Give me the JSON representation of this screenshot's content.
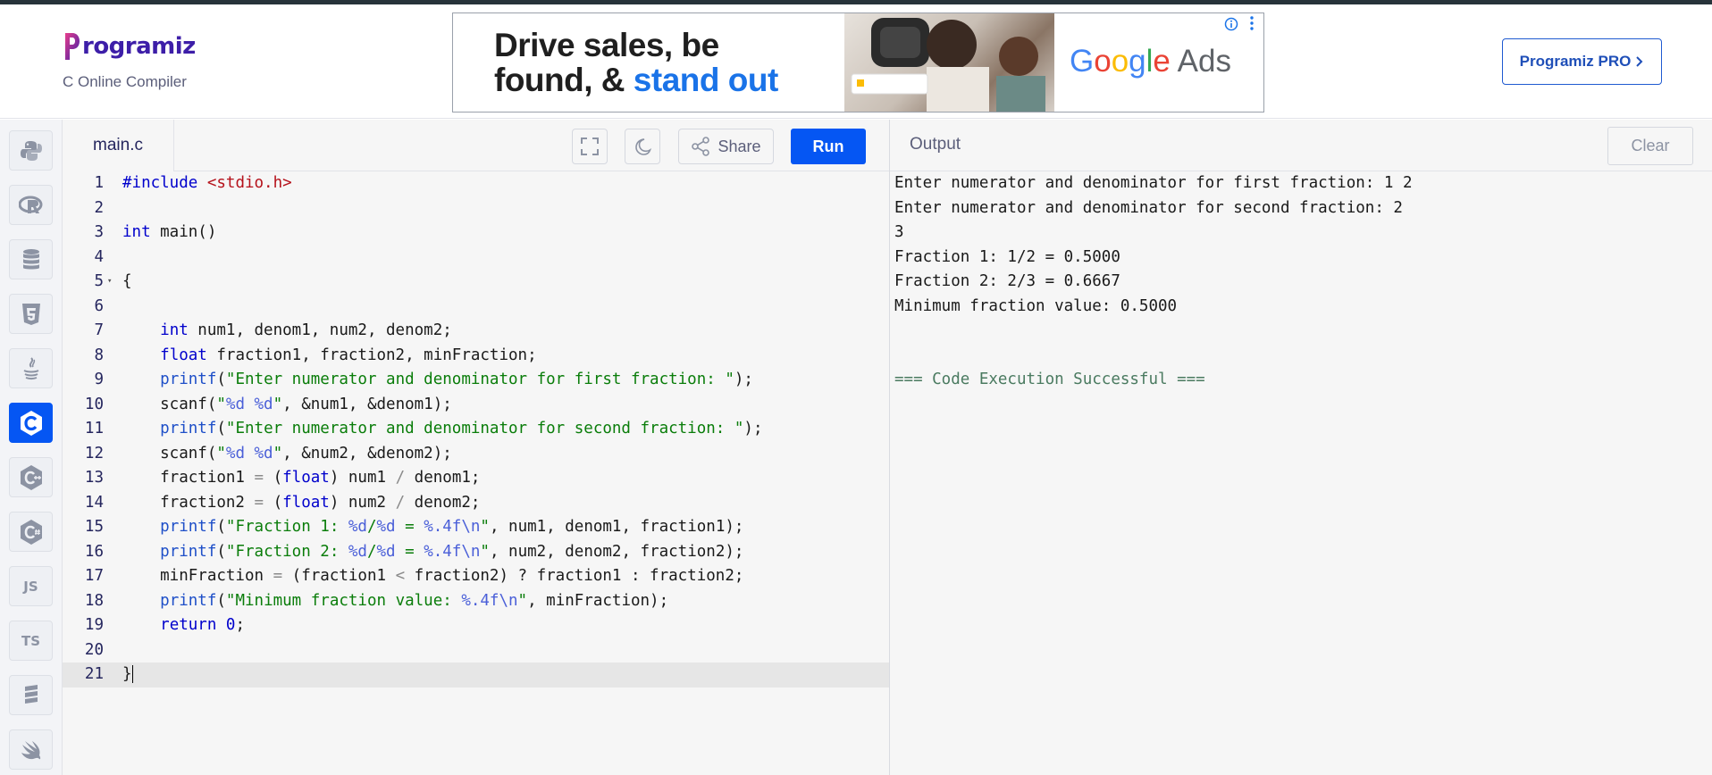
{
  "header": {
    "logo_text": "rogramiz",
    "logo_letter": "P",
    "subtitle": "C Online Compiler",
    "pro_button": "Programiz PRO"
  },
  "ad": {
    "headline_line1": "Drive sales, be",
    "headline_line2_a": "found, & ",
    "headline_line2_b": "stand out",
    "brand_google": [
      "G",
      "o",
      "o",
      "g",
      "l",
      "e"
    ],
    "brand_ads": " Ads"
  },
  "sidebar": {
    "items": [
      {
        "name": "python",
        "icon": "python-icon"
      },
      {
        "name": "r",
        "icon": "r-icon"
      },
      {
        "name": "sql",
        "icon": "database-icon"
      },
      {
        "name": "html",
        "icon": "html5-icon"
      },
      {
        "name": "java",
        "icon": "java-icon"
      },
      {
        "name": "c",
        "icon": "c-icon",
        "active": true
      },
      {
        "name": "cpp",
        "icon": "cpp-icon"
      },
      {
        "name": "csharp",
        "icon": "csharp-icon"
      },
      {
        "name": "js",
        "label": "JS"
      },
      {
        "name": "ts",
        "label": "TS"
      },
      {
        "name": "go",
        "icon": "stack-icon"
      },
      {
        "name": "swift",
        "icon": "swift-icon"
      }
    ]
  },
  "editor": {
    "file_name": "main.c",
    "share_label": "Share",
    "run_label": "Run",
    "line_numbers": [
      "1",
      "2",
      "3",
      "4",
      "5",
      "6",
      "7",
      "8",
      "9",
      "10",
      "11",
      "12",
      "13",
      "14",
      "15",
      "16",
      "17",
      "18",
      "19",
      "20",
      "21"
    ]
  },
  "output": {
    "title": "Output",
    "clear_label": "Clear",
    "lines": [
      "Enter numerator and denominator for first fraction: 1 2",
      "Enter numerator and denominator for second fraction: 2",
      "3",
      "Fraction 1: 1/2 = 0.5000",
      "Fraction 2: 2/3 = 0.6667",
      "Minimum fraction value: 0.5000",
      "",
      "",
      "=== Code Execution Successful ==="
    ]
  },
  "colors": {
    "accent": "#0556f3",
    "brand": "#3d1ea8"
  }
}
